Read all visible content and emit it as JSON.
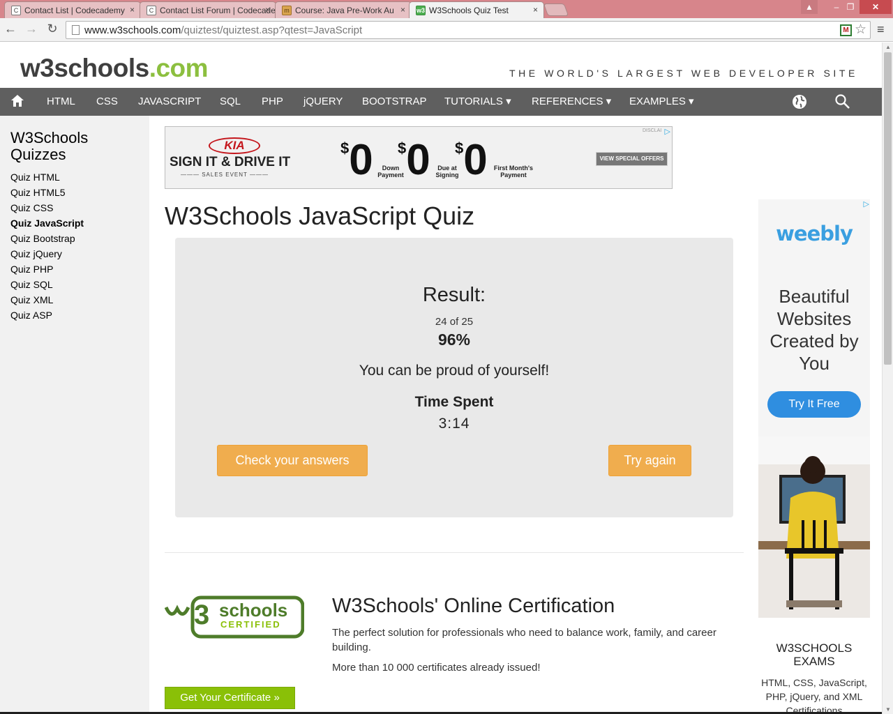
{
  "browser": {
    "tabs": [
      {
        "title": "Contact List | Codecademy",
        "favicon": "codecademy-icon"
      },
      {
        "title": "Contact List Forum | Codecademy",
        "favicon": "codecademy-icon"
      },
      {
        "title": "Course: Java Pre-Work Au",
        "favicon": "course-icon"
      },
      {
        "title": "W3Schools Quiz Test",
        "favicon": "w3schools-icon",
        "active": true
      }
    ],
    "url_host": "www.w3schools.com",
    "url_path": "/quiztest/quiztest.asp?qtest=JavaScript",
    "tab_close_glyph": "×"
  },
  "site": {
    "logo_main": "w3schools",
    "logo_dot": ".com",
    "tagline": "THE WORLD'S LARGEST WEB DEVELOPER SITE",
    "logo_color": "#3f3f3f",
    "accent_green": "#8cbf3f"
  },
  "nav": {
    "items": [
      "HTML",
      "CSS",
      "JAVASCRIPT",
      "SQL",
      "PHP",
      "jQUERY",
      "BOOTSTRAP",
      "TUTORIALS ▾",
      "REFERENCES ▾",
      "EXAMPLES ▾"
    ],
    "background": "#5f5f5f"
  },
  "sidebar": {
    "title": "W3Schools Quizzes",
    "links": [
      "Quiz HTML",
      "Quiz HTML5",
      "Quiz CSS",
      "Quiz JavaScript",
      "Quiz Bootstrap",
      "Quiz jQuery",
      "Quiz PHP",
      "Quiz SQL",
      "Quiz XML",
      "Quiz ASP"
    ],
    "active_link": "Quiz JavaScript"
  },
  "banner_ad": {
    "brand": "KIA",
    "headline": "SIGN IT & DRIVE IT",
    "subline": "SALES EVENT",
    "currency": "$",
    "amounts": [
      "0",
      "0",
      "0"
    ],
    "labels": [
      "Down Payment",
      "Due at Signing",
      "First Month's Payment"
    ],
    "cta": "VIEW SPECIAL OFFERS",
    "disclaimer": "DISCLAI"
  },
  "quiz": {
    "title": "W3Schools JavaScript Quiz",
    "result_heading": "Result:",
    "score": "24 of 25",
    "percent": "96%",
    "message": "You can be proud of yourself!",
    "time_label": "Time Spent",
    "time_value": "3:14",
    "check_button": "Check your answers",
    "retry_button": "Try again",
    "button_color": "#f0ad4e"
  },
  "certification": {
    "title": "W3Schools' Online Certification",
    "text": "The perfect solution for professionals who need to balance work, family, and career building.",
    "text2": "More than 10 000 certificates already issued!",
    "button": "Get Your Certificate »",
    "logo_line1": "schools",
    "logo_line2": "CERTIFIED",
    "button_color": "#8ac007"
  },
  "side_ad": {
    "brand": "weebly",
    "headline": "Beautiful Websites Created by You",
    "cta": "Try It Free"
  },
  "exams": {
    "title": "W3SCHOOLS EXAMS",
    "text": "HTML, CSS, JavaScript, PHP, jQuery, and XML Certifications"
  }
}
